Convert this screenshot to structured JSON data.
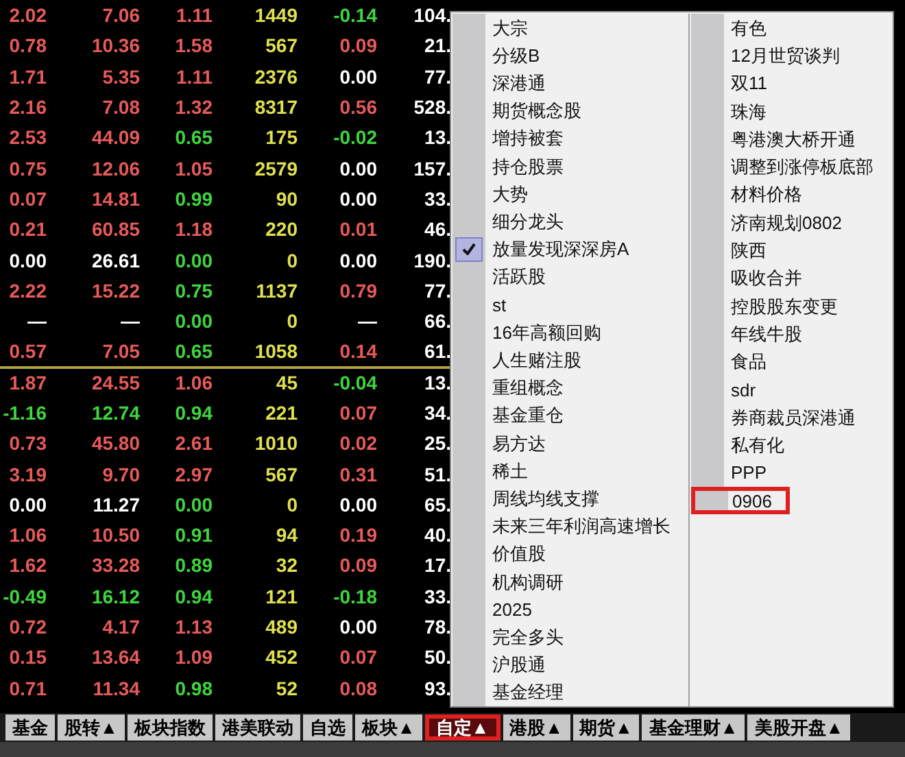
{
  "quote_table": {
    "upper_rows": [
      {
        "cells": [
          {
            "text": "2.02",
            "color": "#e85a5a"
          },
          {
            "text": "7.06",
            "color": "#e85a5a"
          },
          {
            "text": "1.11",
            "color": "#e85a5a"
          },
          {
            "text": "1449",
            "color": "#e0e050"
          },
          {
            "text": "-0.14",
            "color": "#3ed63e"
          },
          {
            "text": "104.",
            "color": "#ffffff"
          }
        ]
      },
      {
        "cells": [
          {
            "text": "0.78",
            "color": "#e85a5a"
          },
          {
            "text": "10.36",
            "color": "#e85a5a"
          },
          {
            "text": "1.58",
            "color": "#e85a5a"
          },
          {
            "text": "567",
            "color": "#e0e050"
          },
          {
            "text": "0.09",
            "color": "#e85a5a"
          },
          {
            "text": "21.",
            "color": "#ffffff"
          }
        ]
      },
      {
        "cells": [
          {
            "text": "1.71",
            "color": "#e85a5a"
          },
          {
            "text": "5.35",
            "color": "#e85a5a"
          },
          {
            "text": "1.11",
            "color": "#e85a5a"
          },
          {
            "text": "2376",
            "color": "#e0e050"
          },
          {
            "text": "0.00",
            "color": "#ffffff"
          },
          {
            "text": "77.",
            "color": "#ffffff"
          }
        ]
      },
      {
        "cells": [
          {
            "text": "2.16",
            "color": "#e85a5a"
          },
          {
            "text": "7.08",
            "color": "#e85a5a"
          },
          {
            "text": "1.32",
            "color": "#e85a5a"
          },
          {
            "text": "8317",
            "color": "#e0e050"
          },
          {
            "text": "0.56",
            "color": "#e85a5a"
          },
          {
            "text": "528.",
            "color": "#ffffff"
          }
        ]
      },
      {
        "cells": [
          {
            "text": "2.53",
            "color": "#e85a5a"
          },
          {
            "text": "44.09",
            "color": "#e85a5a"
          },
          {
            "text": "0.65",
            "color": "#3ed63e"
          },
          {
            "text": "175",
            "color": "#e0e050"
          },
          {
            "text": "-0.02",
            "color": "#3ed63e"
          },
          {
            "text": "13.",
            "color": "#ffffff"
          }
        ]
      },
      {
        "cells": [
          {
            "text": "0.75",
            "color": "#e85a5a"
          },
          {
            "text": "12.06",
            "color": "#e85a5a"
          },
          {
            "text": "1.05",
            "color": "#e85a5a"
          },
          {
            "text": "2579",
            "color": "#e0e050"
          },
          {
            "text": "0.00",
            "color": "#ffffff"
          },
          {
            "text": "157.",
            "color": "#ffffff"
          }
        ]
      },
      {
        "cells": [
          {
            "text": "0.07",
            "color": "#e85a5a"
          },
          {
            "text": "14.81",
            "color": "#e85a5a"
          },
          {
            "text": "0.99",
            "color": "#3ed63e"
          },
          {
            "text": "90",
            "color": "#e0e050"
          },
          {
            "text": "0.00",
            "color": "#ffffff"
          },
          {
            "text": "33.",
            "color": "#ffffff"
          }
        ]
      },
      {
        "cells": [
          {
            "text": "0.21",
            "color": "#e85a5a"
          },
          {
            "text": "60.85",
            "color": "#e85a5a"
          },
          {
            "text": "1.18",
            "color": "#e85a5a"
          },
          {
            "text": "220",
            "color": "#e0e050"
          },
          {
            "text": "0.01",
            "color": "#e85a5a"
          },
          {
            "text": "46.",
            "color": "#ffffff"
          }
        ]
      },
      {
        "cells": [
          {
            "text": "0.00",
            "color": "#ffffff"
          },
          {
            "text": "26.61",
            "color": "#ffffff"
          },
          {
            "text": "0.00",
            "color": "#3ed63e"
          },
          {
            "text": "0",
            "color": "#e0e050"
          },
          {
            "text": "0.00",
            "color": "#ffffff"
          },
          {
            "text": "190.",
            "color": "#ffffff"
          }
        ]
      },
      {
        "cells": [
          {
            "text": "2.22",
            "color": "#e85a5a"
          },
          {
            "text": "15.22",
            "color": "#e85a5a"
          },
          {
            "text": "0.75",
            "color": "#3ed63e"
          },
          {
            "text": "1137",
            "color": "#e0e050"
          },
          {
            "text": "0.79",
            "color": "#e85a5a"
          },
          {
            "text": "77.",
            "color": "#ffffff"
          }
        ]
      },
      {
        "cells": [
          {
            "text": "—",
            "color": "#ffffff"
          },
          {
            "text": "—",
            "color": "#ffffff"
          },
          {
            "text": "0.00",
            "color": "#3ed63e"
          },
          {
            "text": "0",
            "color": "#e0e050"
          },
          {
            "text": "—",
            "color": "#ffffff"
          },
          {
            "text": "66.",
            "color": "#ffffff"
          }
        ]
      },
      {
        "cells": [
          {
            "text": "0.57",
            "color": "#e85a5a"
          },
          {
            "text": "7.05",
            "color": "#e85a5a"
          },
          {
            "text": "0.65",
            "color": "#3ed63e"
          },
          {
            "text": "1058",
            "color": "#e0e050"
          },
          {
            "text": "0.14",
            "color": "#e85a5a"
          },
          {
            "text": "61.",
            "color": "#ffffff"
          }
        ]
      }
    ],
    "lower_rows": [
      {
        "cells": [
          {
            "text": "1.87",
            "color": "#e85a5a"
          },
          {
            "text": "24.55",
            "color": "#e85a5a"
          },
          {
            "text": "1.06",
            "color": "#e85a5a"
          },
          {
            "text": "45",
            "color": "#e0e050"
          },
          {
            "text": "-0.04",
            "color": "#3ed63e"
          },
          {
            "text": "13.",
            "color": "#ffffff"
          }
        ]
      },
      {
        "cells": [
          {
            "text": "-1.16",
            "color": "#3ed63e"
          },
          {
            "text": "12.74",
            "color": "#3ed63e"
          },
          {
            "text": "0.94",
            "color": "#3ed63e"
          },
          {
            "text": "221",
            "color": "#e0e050"
          },
          {
            "text": "0.07",
            "color": "#e85a5a"
          },
          {
            "text": "34.",
            "color": "#ffffff"
          }
        ]
      },
      {
        "cells": [
          {
            "text": "0.73",
            "color": "#e85a5a"
          },
          {
            "text": "45.80",
            "color": "#e85a5a"
          },
          {
            "text": "2.61",
            "color": "#e85a5a"
          },
          {
            "text": "1010",
            "color": "#e0e050"
          },
          {
            "text": "0.02",
            "color": "#e85a5a"
          },
          {
            "text": "25.",
            "color": "#ffffff"
          }
        ]
      },
      {
        "cells": [
          {
            "text": "3.19",
            "color": "#e85a5a"
          },
          {
            "text": "9.70",
            "color": "#e85a5a"
          },
          {
            "text": "2.97",
            "color": "#e85a5a"
          },
          {
            "text": "567",
            "color": "#e0e050"
          },
          {
            "text": "0.31",
            "color": "#e85a5a"
          },
          {
            "text": "51.",
            "color": "#ffffff"
          }
        ]
      },
      {
        "cells": [
          {
            "text": "0.00",
            "color": "#ffffff"
          },
          {
            "text": "11.27",
            "color": "#ffffff"
          },
          {
            "text": "0.00",
            "color": "#3ed63e"
          },
          {
            "text": "0",
            "color": "#e0e050"
          },
          {
            "text": "0.00",
            "color": "#ffffff"
          },
          {
            "text": "65.",
            "color": "#ffffff"
          }
        ]
      },
      {
        "cells": [
          {
            "text": "1.06",
            "color": "#e85a5a"
          },
          {
            "text": "10.50",
            "color": "#e85a5a"
          },
          {
            "text": "0.91",
            "color": "#3ed63e"
          },
          {
            "text": "94",
            "color": "#e0e050"
          },
          {
            "text": "0.19",
            "color": "#e85a5a"
          },
          {
            "text": "40.",
            "color": "#ffffff"
          }
        ]
      },
      {
        "cells": [
          {
            "text": "1.62",
            "color": "#e85a5a"
          },
          {
            "text": "33.28",
            "color": "#e85a5a"
          },
          {
            "text": "0.89",
            "color": "#3ed63e"
          },
          {
            "text": "32",
            "color": "#e0e050"
          },
          {
            "text": "0.09",
            "color": "#e85a5a"
          },
          {
            "text": "17.",
            "color": "#ffffff"
          }
        ]
      },
      {
        "cells": [
          {
            "text": "-0.49",
            "color": "#3ed63e"
          },
          {
            "text": "16.12",
            "color": "#3ed63e"
          },
          {
            "text": "0.94",
            "color": "#3ed63e"
          },
          {
            "text": "121",
            "color": "#e0e050"
          },
          {
            "text": "-0.18",
            "color": "#3ed63e"
          },
          {
            "text": "33.",
            "color": "#ffffff"
          }
        ]
      },
      {
        "cells": [
          {
            "text": "0.72",
            "color": "#e85a5a"
          },
          {
            "text": "4.17",
            "color": "#e85a5a"
          },
          {
            "text": "1.13",
            "color": "#e85a5a"
          },
          {
            "text": "489",
            "color": "#e0e050"
          },
          {
            "text": "0.00",
            "color": "#ffffff"
          },
          {
            "text": "78.",
            "color": "#ffffff"
          }
        ]
      },
      {
        "cells": [
          {
            "text": "0.15",
            "color": "#e85a5a"
          },
          {
            "text": "13.64",
            "color": "#e85a5a"
          },
          {
            "text": "1.09",
            "color": "#e85a5a"
          },
          {
            "text": "452",
            "color": "#e0e050"
          },
          {
            "text": "0.07",
            "color": "#e85a5a"
          },
          {
            "text": "50.",
            "color": "#ffffff"
          }
        ]
      },
      {
        "cells": [
          {
            "text": "0.71",
            "color": "#e85a5a"
          },
          {
            "text": "11.34",
            "color": "#e85a5a"
          },
          {
            "text": "0.98",
            "color": "#3ed63e"
          },
          {
            "text": "52",
            "color": "#e0e050"
          },
          {
            "text": "0.08",
            "color": "#e85a5a"
          },
          {
            "text": "93.",
            "color": "#ffffff"
          }
        ]
      }
    ]
  },
  "menu": {
    "columns": [
      [
        {
          "label": "大宗",
          "checked": false,
          "highlighted": false
        },
        {
          "label": "分级B",
          "checked": false,
          "highlighted": false
        },
        {
          "label": "深港通",
          "checked": false,
          "highlighted": false
        },
        {
          "label": "期货概念股",
          "checked": false,
          "highlighted": false
        },
        {
          "label": "增持被套",
          "checked": false,
          "highlighted": false
        },
        {
          "label": "持仓股票",
          "checked": false,
          "highlighted": false
        },
        {
          "label": "大势",
          "checked": false,
          "highlighted": false
        },
        {
          "label": "细分龙头",
          "checked": false,
          "highlighted": false
        },
        {
          "label": "放量发现深深房A",
          "checked": true,
          "highlighted": false
        },
        {
          "label": "活跃股",
          "checked": false,
          "highlighted": false
        },
        {
          "label": "st",
          "checked": false,
          "highlighted": false
        },
        {
          "label": "16年高额回购",
          "checked": false,
          "highlighted": false
        },
        {
          "label": "人生赌注股",
          "checked": false,
          "highlighted": false
        },
        {
          "label": "重组概念",
          "checked": false,
          "highlighted": false
        },
        {
          "label": "基金重仓",
          "checked": false,
          "highlighted": false
        },
        {
          "label": "易方达",
          "checked": false,
          "highlighted": false
        },
        {
          "label": "稀土",
          "checked": false,
          "highlighted": false
        },
        {
          "label": "周线均线支撑",
          "checked": false,
          "highlighted": false
        },
        {
          "label": "未来三年利润高速增长",
          "checked": false,
          "highlighted": false
        },
        {
          "label": "价值股",
          "checked": false,
          "highlighted": false
        },
        {
          "label": "机构调研",
          "checked": false,
          "highlighted": false
        },
        {
          "label": "2025",
          "checked": false,
          "highlighted": false
        },
        {
          "label": "完全多头",
          "checked": false,
          "highlighted": false
        },
        {
          "label": "沪股通",
          "checked": false,
          "highlighted": false
        },
        {
          "label": "基金经理",
          "checked": false,
          "highlighted": false
        }
      ],
      [
        {
          "label": "有色",
          "checked": false,
          "highlighted": false
        },
        {
          "label": "12月世贸谈判",
          "checked": false,
          "highlighted": false
        },
        {
          "label": "双11",
          "checked": false,
          "highlighted": false
        },
        {
          "label": "珠海",
          "checked": false,
          "highlighted": false
        },
        {
          "label": "粤港澳大桥开通",
          "checked": false,
          "highlighted": false
        },
        {
          "label": "调整到涨停板底部",
          "checked": false,
          "highlighted": false
        },
        {
          "label": "材料价格",
          "checked": false,
          "highlighted": false
        },
        {
          "label": "济南规划0802",
          "checked": false,
          "highlighted": false
        },
        {
          "label": "陕西",
          "checked": false,
          "highlighted": false
        },
        {
          "label": "吸收合并",
          "checked": false,
          "highlighted": false
        },
        {
          "label": "控股股东变更",
          "checked": false,
          "highlighted": false
        },
        {
          "label": "年线牛股",
          "checked": false,
          "highlighted": false
        },
        {
          "label": "食品",
          "checked": false,
          "highlighted": false
        },
        {
          "label": "sdr",
          "checked": false,
          "highlighted": false
        },
        {
          "label": "券商裁员深港通",
          "checked": false,
          "highlighted": false
        },
        {
          "label": "私有化",
          "checked": false,
          "highlighted": false
        },
        {
          "label": "PPP",
          "checked": false,
          "highlighted": false
        },
        {
          "label": "0906",
          "checked": false,
          "highlighted": true
        }
      ]
    ]
  },
  "bottom_tabs": [
    {
      "label": "基金",
      "selected": false,
      "highlighted": false
    },
    {
      "label": "股转▲",
      "selected": false,
      "highlighted": false
    },
    {
      "label": "板块指数",
      "selected": false,
      "highlighted": false
    },
    {
      "label": "港美联动",
      "selected": false,
      "highlighted": false
    },
    {
      "label": "自选",
      "selected": false,
      "highlighted": false
    },
    {
      "label": "板块▲",
      "selected": false,
      "highlighted": false
    },
    {
      "label": "自定▲",
      "selected": true,
      "highlighted": true
    },
    {
      "label": "港股▲",
      "selected": false,
      "highlighted": false
    },
    {
      "label": "期货▲",
      "selected": false,
      "highlighted": false
    },
    {
      "label": "基金理财▲",
      "selected": false,
      "highlighted": false
    },
    {
      "label": "美股开盘▲",
      "selected": false,
      "highlighted": false
    }
  ]
}
